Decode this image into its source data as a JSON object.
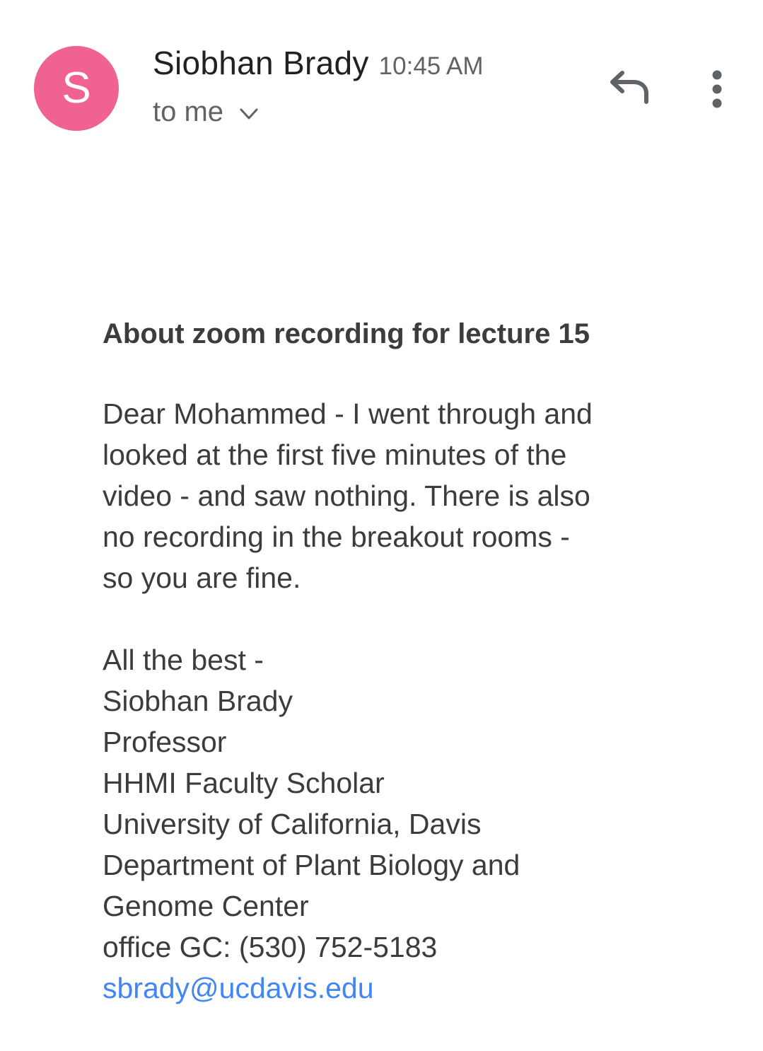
{
  "header": {
    "avatar_letter": "S",
    "avatar_color": "#f06292",
    "sender_name": "Siobhan Brady",
    "time": "10:45 AM",
    "recipient": "to me",
    "reply_icon": "reply-icon",
    "more_icon": "more-vert-icon"
  },
  "message": {
    "subject": "About zoom recording for lecture 15",
    "body_lines": [
      "Dear Mohammed - I went through and",
      "looked at the first five minutes of the",
      "video - and saw nothing. There is also",
      "no recording in the breakout rooms -",
      "so you are fine."
    ],
    "signature": {
      "closing": "All the best -",
      "name": "Siobhan Brady",
      "title": "Professor",
      "honor": "HHMI Faculty Scholar",
      "university": "University of California, Davis",
      "department_line1": "Department of Plant Biology and",
      "department_line2": "Genome Center",
      "office": "office GC: (530) 752-5183",
      "email": "sbrady@ucdavis.edu"
    },
    "link_color": "#4285f4"
  }
}
